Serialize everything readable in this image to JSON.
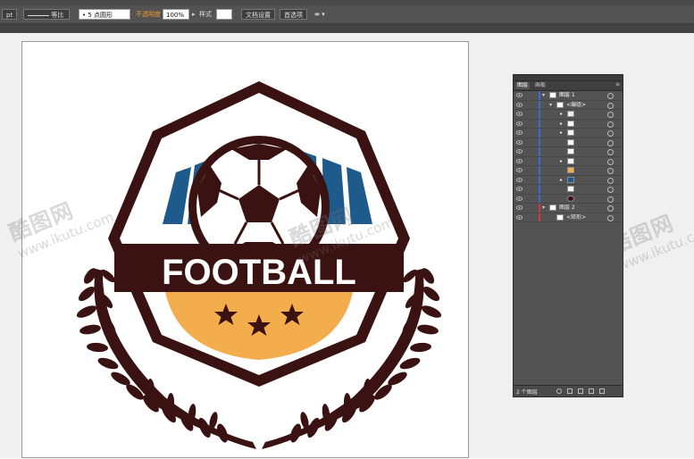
{
  "control_bar": {
    "stroke_unit": "pt",
    "stroke_profile": "等比",
    "brush_label": "5 点圆形",
    "opacity_label": "不透明度",
    "opacity_value": "100%",
    "style_label": "样式",
    "doc_setup_button": "文档设置",
    "prefs_button": "首选项"
  },
  "artwork": {
    "logo_text": "FOOTBALL",
    "colors": {
      "dark_brown": "#3a1212",
      "blue": "#1e5a8c",
      "orange": "#f4ad4c",
      "white": "#ffffff"
    }
  },
  "watermark": {
    "brand": "酷图网",
    "url": "www.ikutu.com"
  },
  "layers_panel": {
    "tab_layers": "图层",
    "tab_artboards": "画板",
    "layer1_name": "图层 1",
    "group_label": "<编组>",
    "layer2_name": "图层 2",
    "rect_label": "<矩形>",
    "footer_count": "2 个图层"
  }
}
